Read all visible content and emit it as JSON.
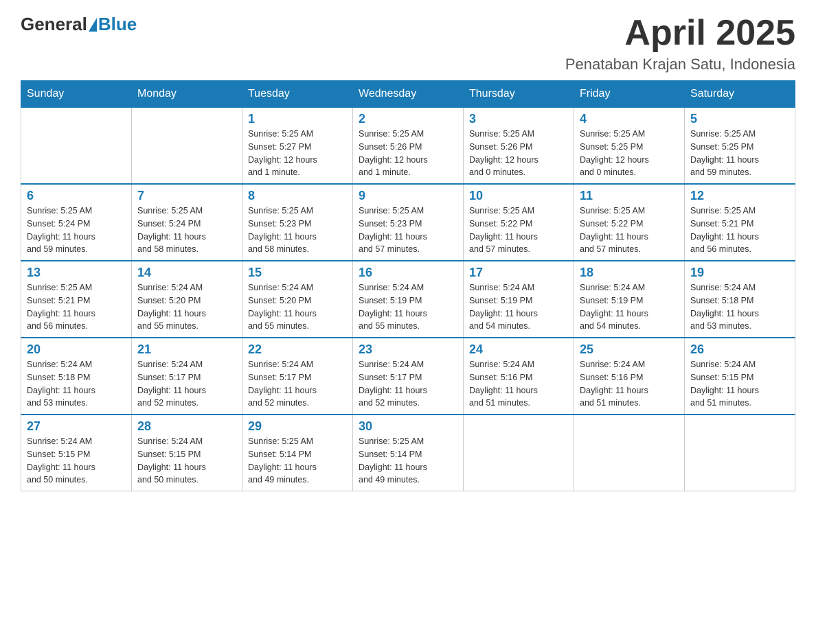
{
  "header": {
    "logo_general": "General",
    "logo_blue": "Blue",
    "month_title": "April 2025",
    "location": "Penataban Krajan Satu, Indonesia"
  },
  "weekdays": [
    "Sunday",
    "Monday",
    "Tuesday",
    "Wednesday",
    "Thursday",
    "Friday",
    "Saturday"
  ],
  "weeks": [
    [
      {
        "day": "",
        "info": ""
      },
      {
        "day": "",
        "info": ""
      },
      {
        "day": "1",
        "info": "Sunrise: 5:25 AM\nSunset: 5:27 PM\nDaylight: 12 hours\nand 1 minute."
      },
      {
        "day": "2",
        "info": "Sunrise: 5:25 AM\nSunset: 5:26 PM\nDaylight: 12 hours\nand 1 minute."
      },
      {
        "day": "3",
        "info": "Sunrise: 5:25 AM\nSunset: 5:26 PM\nDaylight: 12 hours\nand 0 minutes."
      },
      {
        "day": "4",
        "info": "Sunrise: 5:25 AM\nSunset: 5:25 PM\nDaylight: 12 hours\nand 0 minutes."
      },
      {
        "day": "5",
        "info": "Sunrise: 5:25 AM\nSunset: 5:25 PM\nDaylight: 11 hours\nand 59 minutes."
      }
    ],
    [
      {
        "day": "6",
        "info": "Sunrise: 5:25 AM\nSunset: 5:24 PM\nDaylight: 11 hours\nand 59 minutes."
      },
      {
        "day": "7",
        "info": "Sunrise: 5:25 AM\nSunset: 5:24 PM\nDaylight: 11 hours\nand 58 minutes."
      },
      {
        "day": "8",
        "info": "Sunrise: 5:25 AM\nSunset: 5:23 PM\nDaylight: 11 hours\nand 58 minutes."
      },
      {
        "day": "9",
        "info": "Sunrise: 5:25 AM\nSunset: 5:23 PM\nDaylight: 11 hours\nand 57 minutes."
      },
      {
        "day": "10",
        "info": "Sunrise: 5:25 AM\nSunset: 5:22 PM\nDaylight: 11 hours\nand 57 minutes."
      },
      {
        "day": "11",
        "info": "Sunrise: 5:25 AM\nSunset: 5:22 PM\nDaylight: 11 hours\nand 57 minutes."
      },
      {
        "day": "12",
        "info": "Sunrise: 5:25 AM\nSunset: 5:21 PM\nDaylight: 11 hours\nand 56 minutes."
      }
    ],
    [
      {
        "day": "13",
        "info": "Sunrise: 5:25 AM\nSunset: 5:21 PM\nDaylight: 11 hours\nand 56 minutes."
      },
      {
        "day": "14",
        "info": "Sunrise: 5:24 AM\nSunset: 5:20 PM\nDaylight: 11 hours\nand 55 minutes."
      },
      {
        "day": "15",
        "info": "Sunrise: 5:24 AM\nSunset: 5:20 PM\nDaylight: 11 hours\nand 55 minutes."
      },
      {
        "day": "16",
        "info": "Sunrise: 5:24 AM\nSunset: 5:19 PM\nDaylight: 11 hours\nand 55 minutes."
      },
      {
        "day": "17",
        "info": "Sunrise: 5:24 AM\nSunset: 5:19 PM\nDaylight: 11 hours\nand 54 minutes."
      },
      {
        "day": "18",
        "info": "Sunrise: 5:24 AM\nSunset: 5:19 PM\nDaylight: 11 hours\nand 54 minutes."
      },
      {
        "day": "19",
        "info": "Sunrise: 5:24 AM\nSunset: 5:18 PM\nDaylight: 11 hours\nand 53 minutes."
      }
    ],
    [
      {
        "day": "20",
        "info": "Sunrise: 5:24 AM\nSunset: 5:18 PM\nDaylight: 11 hours\nand 53 minutes."
      },
      {
        "day": "21",
        "info": "Sunrise: 5:24 AM\nSunset: 5:17 PM\nDaylight: 11 hours\nand 52 minutes."
      },
      {
        "day": "22",
        "info": "Sunrise: 5:24 AM\nSunset: 5:17 PM\nDaylight: 11 hours\nand 52 minutes."
      },
      {
        "day": "23",
        "info": "Sunrise: 5:24 AM\nSunset: 5:17 PM\nDaylight: 11 hours\nand 52 minutes."
      },
      {
        "day": "24",
        "info": "Sunrise: 5:24 AM\nSunset: 5:16 PM\nDaylight: 11 hours\nand 51 minutes."
      },
      {
        "day": "25",
        "info": "Sunrise: 5:24 AM\nSunset: 5:16 PM\nDaylight: 11 hours\nand 51 minutes."
      },
      {
        "day": "26",
        "info": "Sunrise: 5:24 AM\nSunset: 5:15 PM\nDaylight: 11 hours\nand 51 minutes."
      }
    ],
    [
      {
        "day": "27",
        "info": "Sunrise: 5:24 AM\nSunset: 5:15 PM\nDaylight: 11 hours\nand 50 minutes."
      },
      {
        "day": "28",
        "info": "Sunrise: 5:24 AM\nSunset: 5:15 PM\nDaylight: 11 hours\nand 50 minutes."
      },
      {
        "day": "29",
        "info": "Sunrise: 5:25 AM\nSunset: 5:14 PM\nDaylight: 11 hours\nand 49 minutes."
      },
      {
        "day": "30",
        "info": "Sunrise: 5:25 AM\nSunset: 5:14 PM\nDaylight: 11 hours\nand 49 minutes."
      },
      {
        "day": "",
        "info": ""
      },
      {
        "day": "",
        "info": ""
      },
      {
        "day": "",
        "info": ""
      }
    ]
  ]
}
